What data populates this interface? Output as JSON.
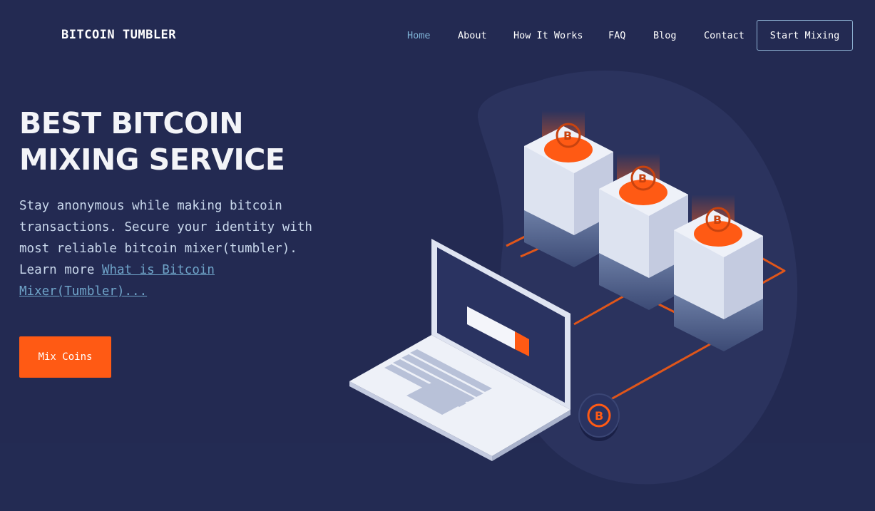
{
  "header": {
    "brand": "BITCOIN TUMBLER",
    "nav": [
      {
        "label": "Home",
        "active": true
      },
      {
        "label": "About"
      },
      {
        "label": "How It Works"
      },
      {
        "label": "FAQ"
      },
      {
        "label": "Blog"
      },
      {
        "label": "Contact"
      }
    ],
    "cta_label": "Start Mixing"
  },
  "hero": {
    "title_line1": "BEST BITCOIN",
    "title_line2": "MIXING SERVICE",
    "description": "Stay anonymous while making bitcoin transactions. Secure your identity with most reliable bitcoin mixer(tumbler). Learn more ",
    "link_text": "What is Bitcoin Mixer(Tumbler)...",
    "button_label": "Mix Coins"
  },
  "illustration": {
    "coin_symbol": "B",
    "icons": [
      "laptop-icon",
      "server-stack-icon",
      "bitcoin-coin-icon"
    ]
  },
  "colors": {
    "background": "#232a52",
    "accent": "#ff5a14",
    "link": "#6fa4c9",
    "nav_active": "#7fb2d6"
  }
}
